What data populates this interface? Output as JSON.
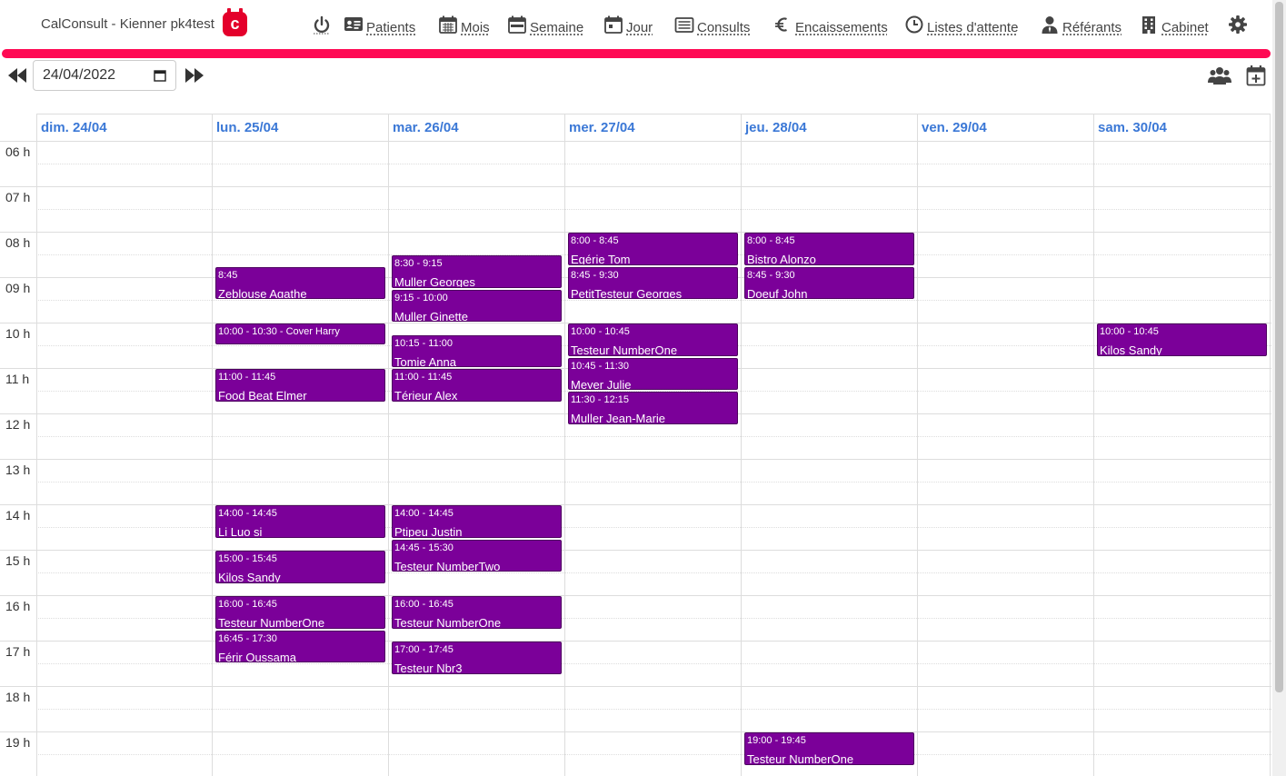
{
  "app": {
    "brand": "CalConsult  - Kienner pk4test",
    "logo_letter": "c",
    "accent_color": "#ff0a54",
    "event_color": "#7b0099"
  },
  "nav": [
    {
      "label": "",
      "icon": "power-icon"
    },
    {
      "label": "Patients",
      "icon": "id-card-icon"
    },
    {
      "label": "Mois",
      "icon": "calendar-month-icon"
    },
    {
      "label": "Semaine",
      "icon": "calendar-week-icon"
    },
    {
      "label": "Jour",
      "icon": "calendar-day-icon"
    },
    {
      "label": "Consults",
      "icon": "list-icon"
    },
    {
      "label": "Encaissements",
      "icon": "euro-icon"
    },
    {
      "label": "Listes d'attente",
      "icon": "clock-icon"
    },
    {
      "label": "Référants",
      "icon": "user-tie-icon"
    },
    {
      "label": "Cabinet",
      "icon": "building-icon"
    },
    {
      "label": "",
      "icon": "gear-icon"
    }
  ],
  "date_picker": {
    "value": "24/04/2022"
  },
  "days": [
    "dim. 24/04",
    "lun. 25/04",
    "mar. 26/04",
    "mer. 27/04",
    "jeu. 28/04",
    "ven. 29/04",
    "sam. 30/04"
  ],
  "hours": [
    "06 h",
    "07 h",
    "08 h",
    "09 h",
    "10 h",
    "11 h",
    "12 h",
    "13 h",
    "14 h",
    "15 h",
    "16 h",
    "17 h",
    "18 h",
    "19 h"
  ],
  "events": [
    {
      "day": 1,
      "start": "8:45",
      "end": "9:30",
      "time": "8:45",
      "title": "Zeblouse Agathe"
    },
    {
      "day": 1,
      "start": "10:00",
      "end": "10:30",
      "time": "10:00 - 10:30 - Cover Harry",
      "title": ""
    },
    {
      "day": 1,
      "start": "11:00",
      "end": "11:45",
      "time": "11:00 - 11:45",
      "title": "Food Beat Elmer"
    },
    {
      "day": 1,
      "start": "14:00",
      "end": "14:45",
      "time": "14:00 - 14:45",
      "title": "Li Luo si"
    },
    {
      "day": 1,
      "start": "15:00",
      "end": "15:45",
      "time": "15:00 - 15:45",
      "title": "Kilos Sandy"
    },
    {
      "day": 1,
      "start": "16:00",
      "end": "16:45",
      "time": "16:00 - 16:45",
      "title": "Testeur NumberOne"
    },
    {
      "day": 1,
      "start": "16:45",
      "end": "17:30",
      "time": "16:45 - 17:30",
      "title": "Férir Oussama"
    },
    {
      "day": 2,
      "start": "8:30",
      "end": "9:15",
      "time": "8:30 - 9:15",
      "title": "Muller Georges"
    },
    {
      "day": 2,
      "start": "9:15",
      "end": "10:00",
      "time": "9:15 - 10:00",
      "title": "Muller Ginette"
    },
    {
      "day": 2,
      "start": "10:15",
      "end": "11:00",
      "time": "10:15 - 11:00",
      "title": "Tomie Anna"
    },
    {
      "day": 2,
      "start": "11:00",
      "end": "11:45",
      "time": "11:00 - 11:45",
      "title": "Térieur Alex"
    },
    {
      "day": 2,
      "start": "14:00",
      "end": "14:45",
      "time": "14:00 - 14:45",
      "title": "Ptipeu Justin"
    },
    {
      "day": 2,
      "start": "14:45",
      "end": "15:30",
      "time": "14:45 - 15:30",
      "title": "Testeur NumberTwo"
    },
    {
      "day": 2,
      "start": "16:00",
      "end": "16:45",
      "time": "16:00 - 16:45",
      "title": "Testeur NumberOne"
    },
    {
      "day": 2,
      "start": "17:00",
      "end": "17:45",
      "time": "17:00 - 17:45",
      "title": "Testeur Nbr3"
    },
    {
      "day": 3,
      "start": "8:00",
      "end": "8:45",
      "time": "8:00 - 8:45",
      "title": "Egérie Tom"
    },
    {
      "day": 3,
      "start": "8:45",
      "end": "9:30",
      "time": "8:45 - 9:30",
      "title": "PetitTesteur Georges"
    },
    {
      "day": 3,
      "start": "10:00",
      "end": "10:45",
      "time": "10:00 - 10:45",
      "title": "Testeur NumberOne"
    },
    {
      "day": 3,
      "start": "10:45",
      "end": "11:30",
      "time": "10:45 - 11:30",
      "title": "Meyer Julie"
    },
    {
      "day": 3,
      "start": "11:30",
      "end": "12:15",
      "time": "11:30 - 12:15",
      "title": "Muller Jean-Marie"
    },
    {
      "day": 4,
      "start": "8:00",
      "end": "8:45",
      "time": "8:00 - 8:45",
      "title": "Bistro Alonzo"
    },
    {
      "day": 4,
      "start": "8:45",
      "end": "9:30",
      "time": "8:45 - 9:30",
      "title": "Doeuf John"
    },
    {
      "day": 4,
      "start": "19:00",
      "end": "19:45",
      "time": "19:00 - 19:45",
      "title": "Testeur NumberOne"
    },
    {
      "day": 6,
      "start": "10:00",
      "end": "10:45",
      "time": "10:00 - 10:45",
      "title": "Kilos Sandy"
    }
  ]
}
